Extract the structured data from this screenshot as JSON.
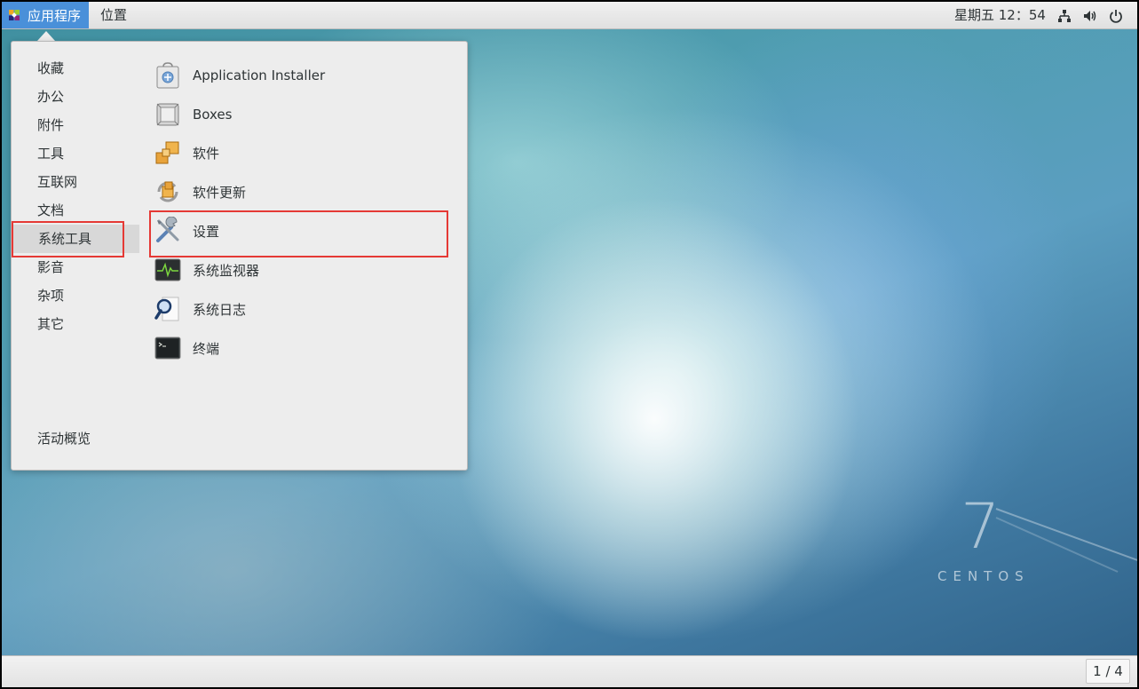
{
  "topbar": {
    "applications_label": "应用程序",
    "places_label": "位置",
    "clock": "星期五 12：54",
    "tray_icons": [
      "network-icon",
      "volume-icon",
      "power-icon"
    ]
  },
  "menu": {
    "categories": [
      "收藏",
      "办公",
      "附件",
      "工具",
      "互联网",
      "文档",
      "系统工具",
      "影音",
      "杂项",
      "其它"
    ],
    "selected_category": "系统工具",
    "apps": [
      {
        "label": "Application Installer",
        "icon": "app-installer-icon"
      },
      {
        "label": "Boxes",
        "icon": "boxes-icon"
      },
      {
        "label": "软件",
        "icon": "software-icon"
      },
      {
        "label": "软件更新",
        "icon": "software-update-icon"
      },
      {
        "label": "设置",
        "icon": "settings-icon"
      },
      {
        "label": "系统监视器",
        "icon": "system-monitor-icon"
      },
      {
        "label": "系统日志",
        "icon": "system-log-icon"
      },
      {
        "label": "终端",
        "icon": "terminal-icon"
      }
    ],
    "overview_label": "活动概览"
  },
  "desktop": {
    "brand_number": "7",
    "brand_word": "CENTOS"
  },
  "bottombar": {
    "workspace": "1 / 4"
  },
  "colors": {
    "accent": "#4a90d9",
    "highlight_box": "#e53935"
  }
}
